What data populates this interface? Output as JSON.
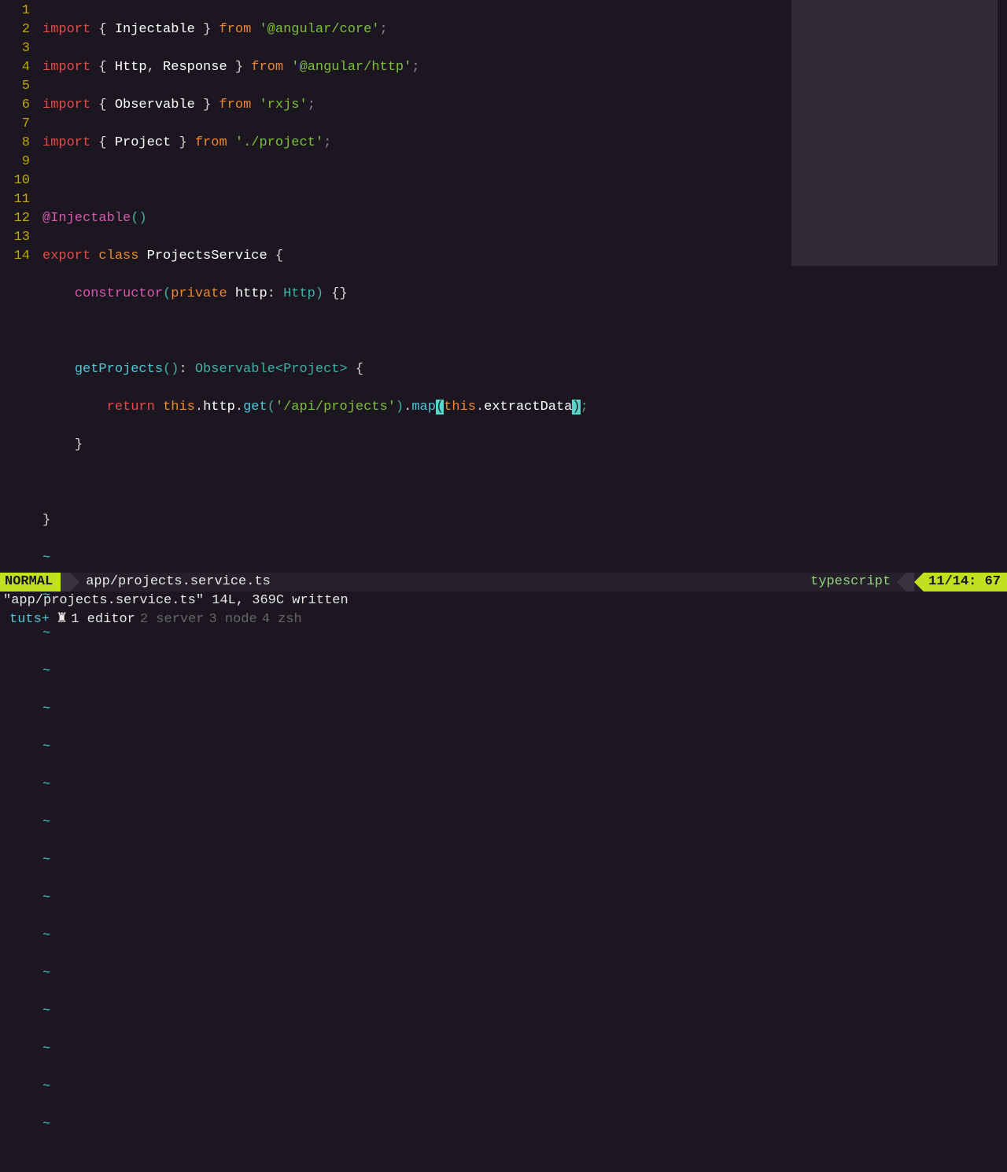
{
  "lines": [
    "1",
    "2",
    "3",
    "4",
    "5",
    "6",
    "7",
    "8",
    "9",
    "10",
    "11",
    "12",
    "13",
    "14"
  ],
  "code": {
    "l1": {
      "import": "import",
      "lb": "{",
      "cls": "Injectable",
      "rb": "}",
      "from": "from",
      "str": "'@angular/core'",
      "semi": ";"
    },
    "l2": {
      "import": "import",
      "lb": "{",
      "a": "Http",
      "comma": ",",
      "b": "Response",
      "rb": "}",
      "from": "from",
      "str": "'@angular/http'",
      "semi": ";"
    },
    "l3": {
      "import": "import",
      "lb": "{",
      "cls": "Observable",
      "rb": "}",
      "from": "from",
      "str": "'rxjs'",
      "semi": ";"
    },
    "l4": {
      "import": "import",
      "lb": "{",
      "cls": "Project",
      "rb": "}",
      "from": "from",
      "str": "'./project'",
      "semi": ";"
    },
    "l6": {
      "at": "@",
      "dec": "Injectable",
      "lp": "(",
      "rp": ")"
    },
    "l7": {
      "export": "export",
      "class": "class",
      "name": "ProjectsService",
      "lb": "{"
    },
    "l8": {
      "ctor": "constructor",
      "lp": "(",
      "priv": "private",
      "param": "http",
      "colon": ":",
      "type": "Http",
      "rp": ")",
      "body": "{}"
    },
    "l10": {
      "fn": "getProjects",
      "lp": "(",
      "rp": ")",
      "colon": ":",
      "type": "Observable",
      "lt": "<",
      "gen": "Project",
      "gt": ">",
      "lb": "{"
    },
    "l11": {
      "ret": "return",
      "this1": "this",
      "dot1": ".",
      "prop1": "http",
      "dot2": ".",
      "m1": "get",
      "lp1": "(",
      "str": "'/api/projects'",
      "rp1": ")",
      "dot3": ".",
      "m2": "map",
      "lp2": "(",
      "this2": "this",
      "dot4": ".",
      "prop2": "extractData",
      "rp2": ")",
      "semi": ";"
    },
    "l12": {
      "rb": "}"
    },
    "l14": {
      "rb": "}"
    }
  },
  "statusbar": {
    "mode": "NORMAL",
    "file": "app/projects.service.ts",
    "filetype": "typescript",
    "position": "11/14: 67"
  },
  "message": "\"app/projects.service.ts\" 14L, 369C written",
  "tmux": {
    "session": "tuts+",
    "icon": "♜",
    "windows": [
      {
        "num": "1",
        "name": "editor",
        "active": true
      },
      {
        "num": "2",
        "name": "server",
        "active": false
      },
      {
        "num": "3",
        "name": "node",
        "active": false
      },
      {
        "num": "4",
        "name": "zsh",
        "active": false
      }
    ]
  }
}
